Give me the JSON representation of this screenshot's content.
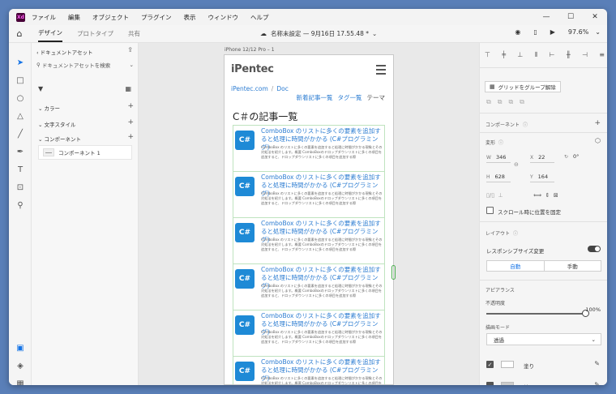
{
  "app": {
    "logo": "Xd",
    "menu": [
      "ファイル",
      "編集",
      "オブジェクト",
      "プラグイン",
      "表示",
      "ウィンドウ",
      "ヘルプ"
    ],
    "window_controls": [
      "—",
      "☐",
      "✕"
    ]
  },
  "toolbar": {
    "tabs": [
      "デザイン",
      "プロトタイプ",
      "共有"
    ],
    "active_tab": "デザイン",
    "doc_title": "名称未設定 — 9月16日 17.55.48 *",
    "zoom": "97.6%"
  },
  "assets": {
    "title": "ドキュメントアセット",
    "search_placeholder": "ドキュメントアセットを検索",
    "sections": [
      "カラー",
      "文字スタイル",
      "コンポーネント"
    ],
    "component_item": "コンポーネント 1"
  },
  "canvas": {
    "artboard_label": "iPhone 12/12 Pro – 1",
    "logo_main": "iPentec",
    "breadcrumb": [
      "iPentec.com",
      "Doc"
    ],
    "nav": [
      "新着記事一覧",
      "タグ一覧",
      "テーマ"
    ],
    "page_title": "C＃の記事一覧",
    "cards": [
      {
        "icon": "C#",
        "title": "ComboBox のリストに多くの要素を追加すると処理に時間がかかる (C#プログラミング)",
        "desc": "ComboBox のリストに多くの要素を追加すると処理に時間がかかる現象とその対処法を紹介します。概要 ComboBoxのドロップダウンリストに多くの項目を追加すると、ドロップダウンリストに多くの項目を追加する際"
      },
      {
        "icon": "C#",
        "title": "ComboBox のリストに多くの要素を追加すると処理に時間がかかる (C#プログラミング)",
        "desc": "ComboBox のリストに多くの要素を追加すると処理に時間がかかる現象とその対処法を紹介します。概要 ComboBoxのドロップダウンリストに多くの項目を追加すると、ドロップダウンリストに多くの項目を追加する際"
      },
      {
        "icon": "C#",
        "title": "ComboBox のリストに多くの要素を追加すると処理に時間がかかる (C#プログラミング)",
        "desc": "ComboBox のリストに多くの要素を追加すると処理に時間がかかる現象とその対処法を紹介します。概要 ComboBoxのドロップダウンリストに多くの項目を追加すると、ドロップダウンリストに多くの項目を追加する際"
      },
      {
        "icon": "C#",
        "title": "ComboBox のリストに多くの要素を追加すると処理に時間がかかる (C#プログラミング)",
        "desc": "ComboBox のリストに多くの要素を追加すると処理に時間がかかる現象とその対処法を紹介します。概要 ComboBoxのドロップダウンリストに多くの項目を追加すると、ドロップダウンリストに多くの項目を追加する際"
      },
      {
        "icon": "C#",
        "title": "ComboBox のリストに多くの要素を追加すると処理に時間がかかる (C#プログラミング)",
        "desc": "ComboBox のリストに多くの要素を追加すると処理に時間がかかる現象とその対処法を紹介します。概要 ComboBoxのドロップダウンリストに多くの項目を追加すると、ドロップダウンリストに多くの項目を追加する際"
      },
      {
        "icon": "C#",
        "title": "ComboBox のリストに多くの要素を追加すると処理に時間がかかる (C#プログラミング)",
        "desc": "ComboBox のリストに多くの要素を追加すると処理に時間がかかる現象とその対処法を紹介します。概要 ComboBoxのドロップダウンリストに多くの項目を追加すると、ドロップダウンリストに多くの項目を追加する際"
      }
    ]
  },
  "props": {
    "ungroup_label": "グリッドをグループ解除",
    "component_label": "コンポーネント",
    "transform_label": "変形",
    "w": "346",
    "x": "22",
    "rotation": "0°",
    "h": "628",
    "y": "164",
    "fix_scroll_label": "スクロール時に位置を固定",
    "layout_label": "レイアウト",
    "responsive_label": "レスポンシブサイズ変更",
    "seg_auto": "自動",
    "seg_manual": "手動",
    "appearance_label": "アピアランス",
    "opacity_label": "不透明度",
    "opacity_value": "100%",
    "blend_label": "描画モード",
    "blend_value": "透過",
    "fill_label": "塗り",
    "border_label": "線"
  },
  "colors": {
    "accent": "#1473e6",
    "link": "#2d7dd2",
    "csharp_icon": "#1e8ad6",
    "card_border": "#bfe3bf"
  }
}
